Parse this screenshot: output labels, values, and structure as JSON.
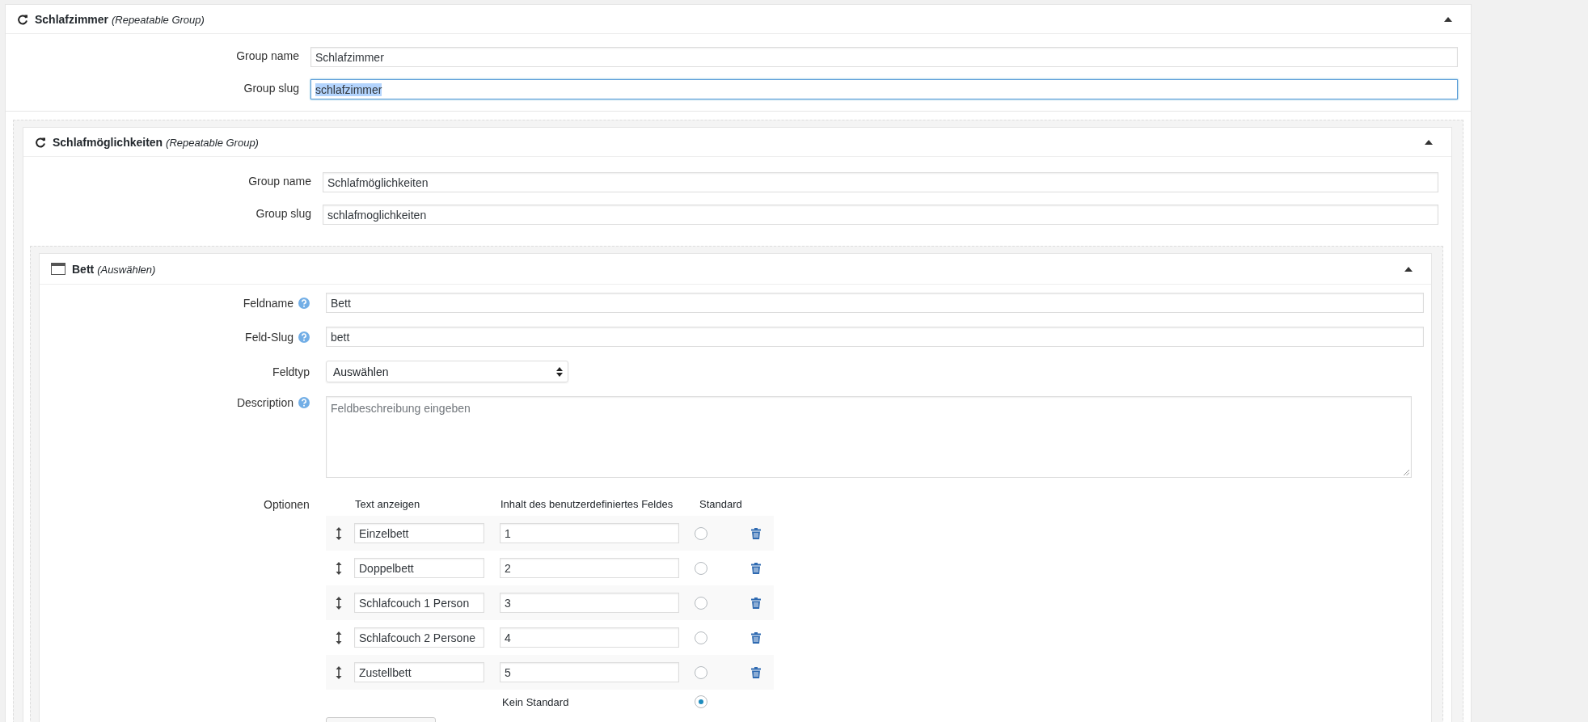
{
  "group": {
    "title": "Schlafzimmer",
    "subtitle": "(Repeatable Group)",
    "expanded": true,
    "fields": [
      {
        "label": "Group name",
        "value": "Schlafzimmer",
        "focused": false,
        "text_selected": false
      },
      {
        "label": "Group slug",
        "value": "schlafzimmer",
        "focused": true,
        "text_selected": true
      }
    ],
    "subgroup": {
      "title": "Schlafmöglichkeiten",
      "subtitle": "(Repeatable Group)",
      "expanded": true,
      "fields": [
        {
          "label": "Group name",
          "value": "Schlafmöglichkeiten",
          "focused": false,
          "text_selected": false
        },
        {
          "label": "Group slug",
          "value": "schlafmoglichkeiten",
          "focused": false,
          "text_selected": false
        }
      ],
      "field": {
        "title": "Bett",
        "subtitle": "(Auswählen)",
        "expanded": true,
        "rows": [
          {
            "kind": "text",
            "label": "Feldname",
            "help": true,
            "value": "Bett"
          },
          {
            "kind": "text",
            "label": "Feld-Slug",
            "help": true,
            "value": "bett"
          },
          {
            "kind": "select",
            "label": "Feldtyp",
            "help": false,
            "value": "Auswählen"
          },
          {
            "kind": "textarea",
            "label": "Description",
            "help": true,
            "placeholder": "Feldbeschreibung eingeben"
          }
        ],
        "options": {
          "label": "Optionen",
          "columns": [
            "Text anzeigen",
            "Inhalt des benutzerdefiniertes Feldes",
            "Standard"
          ],
          "rows": [
            {
              "text": "Einzelbett",
              "value": "1",
              "selected": false
            },
            {
              "text": "Doppelbett",
              "value": "2",
              "selected": false
            },
            {
              "text": "Schlafcouch 1 Person",
              "value": "3",
              "selected": false
            },
            {
              "text": "Schlafcouch 2 Persone",
              "value": "4",
              "selected": false
            },
            {
              "text": "Zustellbett",
              "value": "5",
              "selected": false
            }
          ],
          "none": {
            "label": "Kein Standard",
            "selected": true
          }
        }
      }
    }
  }
}
